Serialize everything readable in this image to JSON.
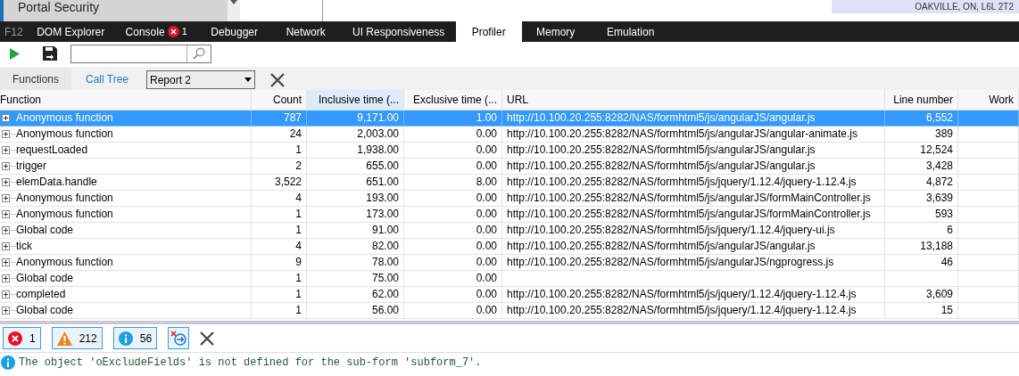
{
  "page_behind": {
    "sidebar_item": "Portal Security",
    "address": "OAKVILLE, ON, L6L 2T2"
  },
  "devtools": {
    "label": "F12",
    "tabs": [
      {
        "label": "DOM Explorer",
        "selected": false
      },
      {
        "label": "Console",
        "selected": false,
        "error_count": "1"
      },
      {
        "label": "Debugger",
        "selected": false
      },
      {
        "label": "Network",
        "selected": false
      },
      {
        "label": "UI Responsiveness",
        "selected": false
      },
      {
        "label": "Profiler",
        "selected": true
      },
      {
        "label": "Memory",
        "selected": false
      },
      {
        "label": "Emulation",
        "selected": false
      }
    ]
  },
  "profiler": {
    "views": [
      {
        "label": "Functions",
        "selected": false
      },
      {
        "label": "Call Tree",
        "selected": true
      }
    ],
    "report": "Report 2",
    "columns": [
      "Function",
      "Count",
      "Inclusive time (...",
      "Exclusive time (...",
      "URL",
      "Line number",
      "Work"
    ],
    "rows": [
      {
        "selected": true,
        "function": "Anonymous function",
        "count": "787",
        "inclusive": "9,171.00",
        "exclusive": "1.00",
        "url": "http://10.100.20.255:8282/NAS/formhtml5/js/angularJS/angular.js",
        "line": "6,552"
      },
      {
        "selected": false,
        "function": "Anonymous function",
        "count": "24",
        "inclusive": "2,003.00",
        "exclusive": "0.00",
        "url": "http://10.100.20.255:8282/NAS/formhtml5/js/angularJS/angular-animate.js",
        "line": "389"
      },
      {
        "selected": false,
        "function": "requestLoaded",
        "count": "1",
        "inclusive": "1,938.00",
        "exclusive": "0.00",
        "url": "http://10.100.20.255:8282/NAS/formhtml5/js/angularJS/angular.js",
        "line": "12,524"
      },
      {
        "selected": false,
        "function": "trigger",
        "count": "2",
        "inclusive": "655.00",
        "exclusive": "0.00",
        "url": "http://10.100.20.255:8282/NAS/formhtml5/js/angularJS/angular.js",
        "line": "3,428"
      },
      {
        "selected": false,
        "function": "elemData.handle",
        "count": "3,522",
        "inclusive": "651.00",
        "exclusive": "8.00",
        "url": "http://10.100.20.255:8282/NAS/formhtml5/js/jquery/1.12.4/jquery-1.12.4.js",
        "line": "4,872"
      },
      {
        "selected": false,
        "function": "Anonymous function",
        "count": "4",
        "inclusive": "193.00",
        "exclusive": "0.00",
        "url": "http://10.100.20.255:8282/NAS/formhtml5/js/angularJS/formMainController.js",
        "line": "3,639"
      },
      {
        "selected": false,
        "function": "Anonymous function",
        "count": "1",
        "inclusive": "173.00",
        "exclusive": "0.00",
        "url": "http://10.100.20.255:8282/NAS/formhtml5/js/angularJS/formMainController.js",
        "line": "593"
      },
      {
        "selected": false,
        "function": "Global code",
        "count": "1",
        "inclusive": "91.00",
        "exclusive": "0.00",
        "url": "http://10.100.20.255:8282/NAS/formhtml5/js/jquery/1.12.4/jquery-ui.js",
        "line": "6"
      },
      {
        "selected": false,
        "function": "tick",
        "count": "4",
        "inclusive": "82.00",
        "exclusive": "0.00",
        "url": "http://10.100.20.255:8282/NAS/formhtml5/js/angularJS/angular.js",
        "line": "13,188"
      },
      {
        "selected": false,
        "function": "Anonymous function",
        "count": "9",
        "inclusive": "78.00",
        "exclusive": "0.00",
        "url": "http://10.100.20.255:8282/NAS/formhtml5/js/angularJS/ngprogress.js",
        "line": "46"
      },
      {
        "selected": false,
        "function": "Global code",
        "count": "1",
        "inclusive": "75.00",
        "exclusive": "0.00"
      },
      {
        "selected": false,
        "function": "completed",
        "count": "1",
        "inclusive": "62.00",
        "exclusive": "0.00",
        "url": "http://10.100.20.255:8282/NAS/formhtml5/js/jquery/1.12.4/jquery-1.12.4.js",
        "line": "3,609"
      },
      {
        "selected": false,
        "function": "Global code",
        "count": "1",
        "inclusive": "56.00",
        "exclusive": "0.00",
        "url": "http://10.100.20.255:8282/NAS/formhtml5/js/jquery/1.12.4/jquery-1.12.4.js",
        "line": "15"
      }
    ]
  },
  "console": {
    "filters": [
      {
        "kind": "error",
        "count": "1"
      },
      {
        "kind": "warning",
        "count": "212"
      },
      {
        "kind": "info",
        "count": "56"
      }
    ],
    "messages": [
      {
        "kind": "info",
        "text": "The object 'oExcludeFields' is not defined for the sub-form 'subform_7'."
      }
    ]
  }
}
